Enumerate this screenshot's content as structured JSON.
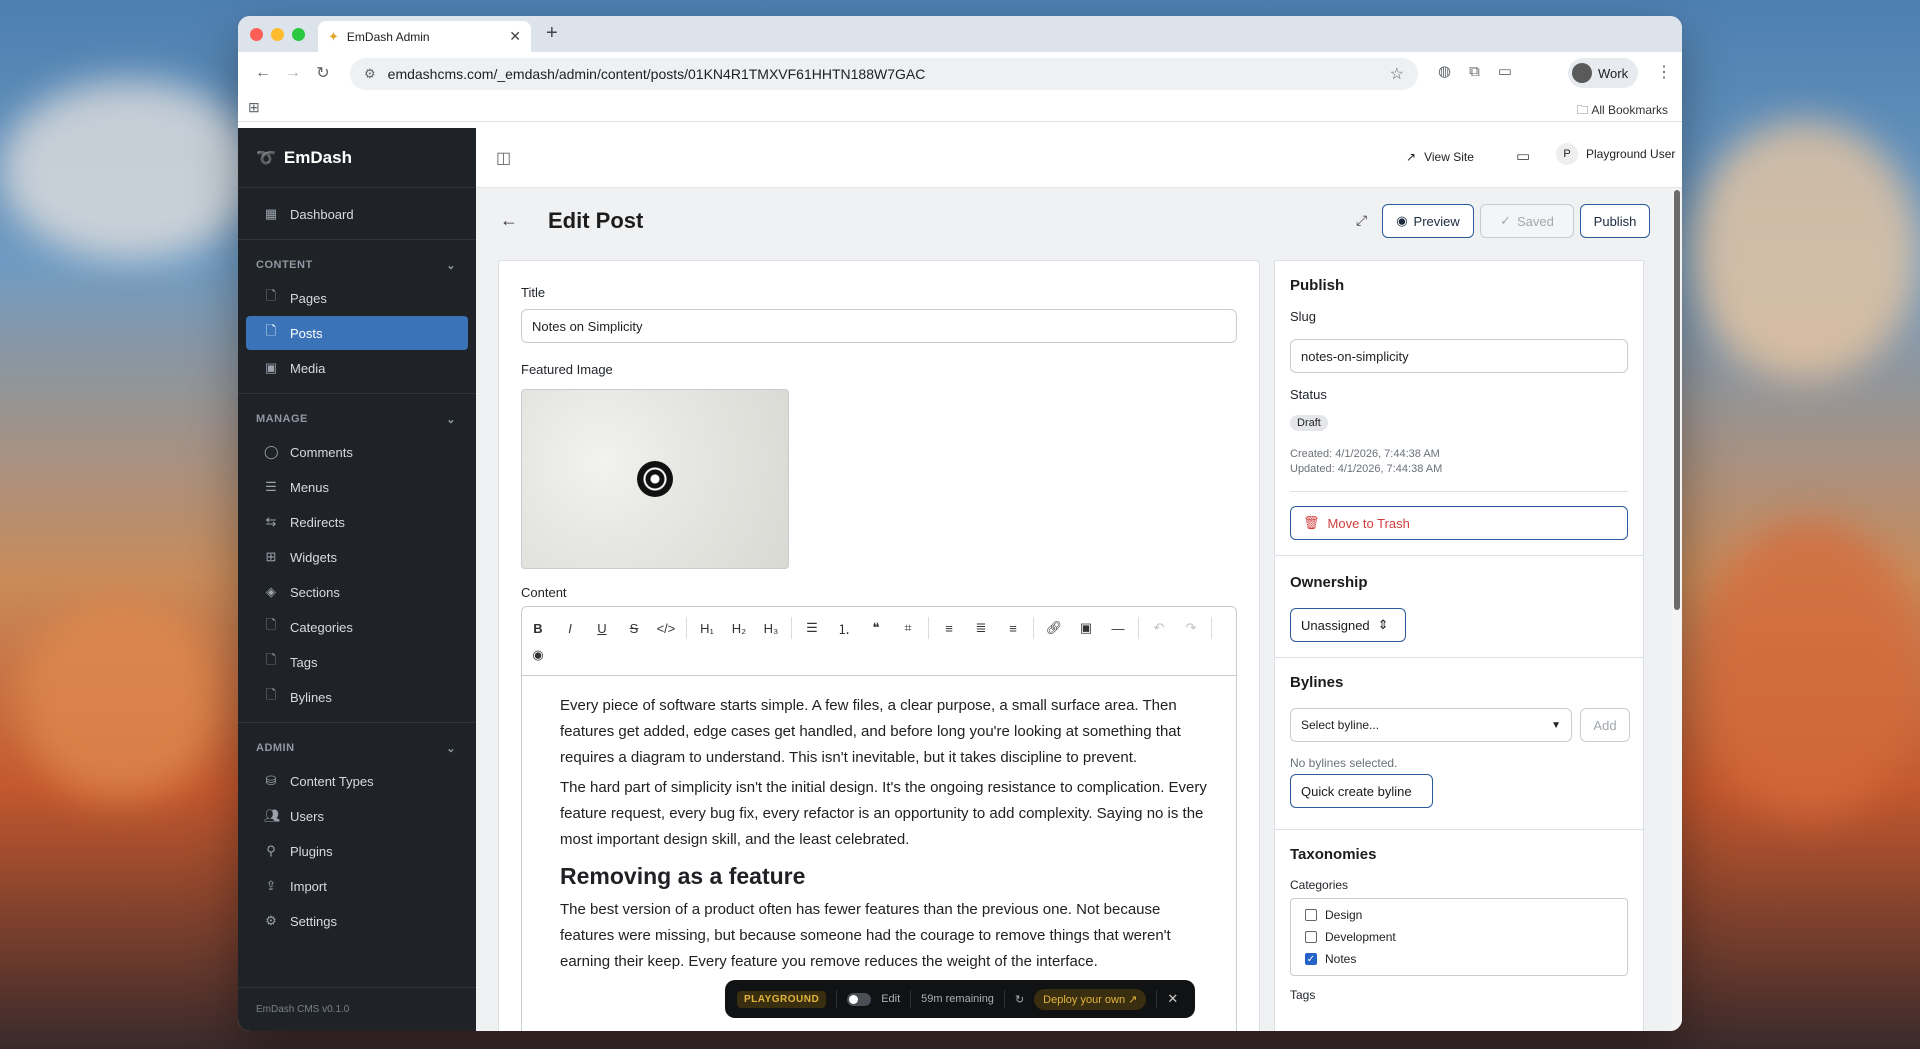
{
  "browser": {
    "tab_title": "EmDash Admin",
    "url": "emdashcms.com/_emdash/admin/content/posts/01KN4R1TMXVF61HHTN188W7GAC",
    "profile": "Work",
    "bookmarks_label": "All Bookmarks"
  },
  "sidebar": {
    "brand": "EmDash",
    "dashboard": "Dashboard",
    "content_header": "CONTENT",
    "content_items": [
      "Pages",
      "Posts",
      "Media"
    ],
    "manage_header": "MANAGE",
    "manage_items": [
      "Comments",
      "Menus",
      "Redirects",
      "Widgets",
      "Sections",
      "Categories",
      "Tags",
      "Bylines"
    ],
    "admin_header": "ADMIN",
    "admin_items": [
      "Content Types",
      "Users",
      "Plugins",
      "Import",
      "Settings"
    ],
    "footer": "EmDash CMS v0.1.0"
  },
  "topbar": {
    "view_site": "View Site",
    "user_initial": "P",
    "user_name": "Playground User"
  },
  "header": {
    "title": "Edit Post",
    "preview": "Preview",
    "saved": "Saved",
    "publish": "Publish"
  },
  "editor": {
    "title_label": "Title",
    "title_value": "Notes on Simplicity",
    "featured_label": "Featured Image",
    "content_label": "Content",
    "paragraphs": [
      "Every piece of software starts simple. A few files, a clear purpose, a small surface area. Then features get added, edge cases get handled, and before long you're looking at something that requires a diagram to understand. This isn't inevitable, but it takes discipline to prevent.",
      "The hard part of simplicity isn't the initial design. It's the ongoing resistance to complication. Every feature request, every bug fix, every refactor is an opportunity to add complexity. Saying no is the most important design skill, and the least celebrated."
    ],
    "heading": "Removing as a feature",
    "paragraph3": "The best version of a product often has fewer features than the previous one. Not because features were missing, but because someone had the courage to remove things that weren't earning their keep. Every feature you remove reduces the weight of the interface."
  },
  "publish_panel": {
    "title": "Publish",
    "slug_label": "Slug",
    "slug_value": "notes-on-simplicity",
    "status_label": "Status",
    "status_value": "Draft",
    "created": "Created: 4/1/2026, 7:44:38 AM",
    "updated": "Updated: 4/1/2026, 7:44:38 AM",
    "trash": "Move to Trash"
  },
  "ownership": {
    "title": "Ownership",
    "value": "Unassigned"
  },
  "bylines": {
    "title": "Bylines",
    "select_placeholder": "Select byline...",
    "add": "Add",
    "empty": "No bylines selected.",
    "quick_create": "Quick create byline"
  },
  "taxonomies": {
    "title": "Taxonomies",
    "categories_label": "Categories",
    "categories": [
      {
        "name": "Design",
        "checked": false
      },
      {
        "name": "Development",
        "checked": false
      },
      {
        "name": "Notes",
        "checked": true
      }
    ],
    "tags_label": "Tags"
  },
  "playground": {
    "tag": "PLAYGROUND",
    "edit": "Edit",
    "remaining": "59m remaining",
    "deploy": "Deploy your own"
  }
}
